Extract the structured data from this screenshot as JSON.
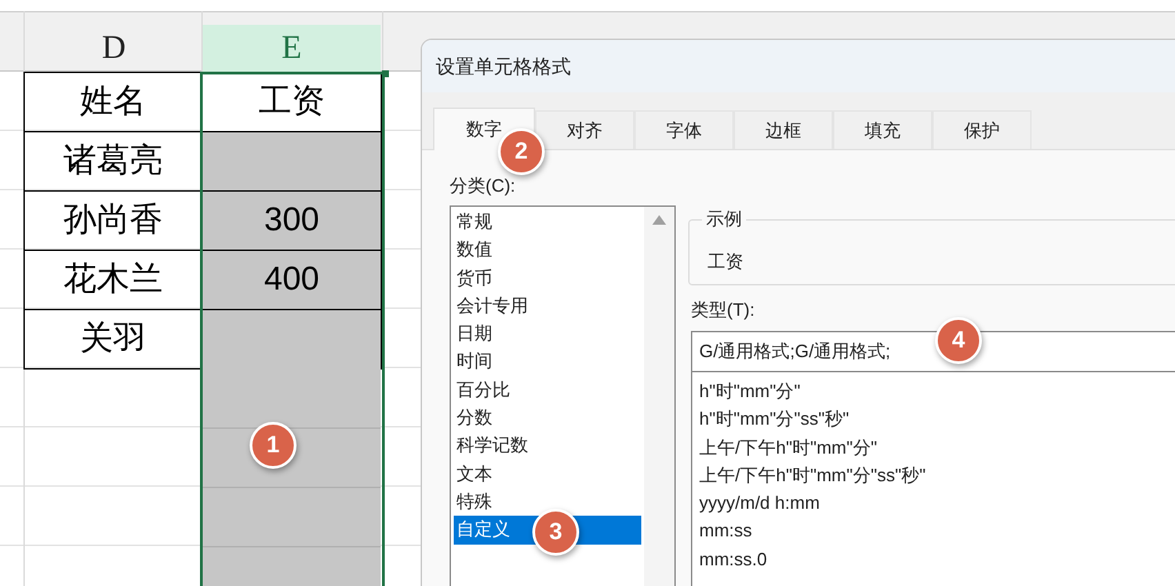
{
  "sheet": {
    "columns": [
      {
        "label": "D",
        "selected": false
      },
      {
        "label": "E",
        "selected": true
      }
    ],
    "rows": [
      {
        "name": "姓名",
        "salary": "工资",
        "selected": false
      },
      {
        "name": "诸葛亮",
        "selected": true
      },
      {
        "name": "孙尚香",
        "salary": "300",
        "selected": true
      },
      {
        "name": "花木兰",
        "salary": "400",
        "selected": true
      },
      {
        "name": "关羽",
        "selected": true
      }
    ]
  },
  "dialog": {
    "title": "设置单元格格式",
    "tabs": [
      {
        "label": "数字",
        "selected": true
      },
      {
        "label": "对齐",
        "selected": false
      },
      {
        "label": "字体",
        "selected": false
      },
      {
        "label": "边框",
        "selected": false
      },
      {
        "label": "填充",
        "selected": false
      },
      {
        "label": "保护",
        "selected": false
      }
    ],
    "category_label": "分类(C):",
    "categories": [
      {
        "label": "常规",
        "selected": false
      },
      {
        "label": "数值",
        "selected": false
      },
      {
        "label": "货币",
        "selected": false
      },
      {
        "label": "会计专用",
        "selected": false
      },
      {
        "label": "日期",
        "selected": false
      },
      {
        "label": "时间",
        "selected": false
      },
      {
        "label": "百分比",
        "selected": false
      },
      {
        "label": "分数",
        "selected": false
      },
      {
        "label": "科学记数",
        "selected": false
      },
      {
        "label": "文本",
        "selected": false
      },
      {
        "label": "特殊",
        "selected": false
      },
      {
        "label": "自定义",
        "selected": true
      }
    ],
    "sample_label": "示例",
    "sample_value": "工资",
    "type_label": "类型(T):",
    "type_value": "G/通用格式;G/通用格式;",
    "type_list": [
      "h\"时\"mm\"分\"",
      "h\"时\"mm\"分\"ss\"秒\"",
      "上午/下午h\"时\"mm\"分\"",
      "上午/下午h\"时\"mm\"分\"ss\"秒\"",
      "yyyy/m/d h:mm",
      "mm:ss",
      "mm:ss.0"
    ]
  },
  "steps": [
    "1",
    "2",
    "3",
    "4"
  ]
}
